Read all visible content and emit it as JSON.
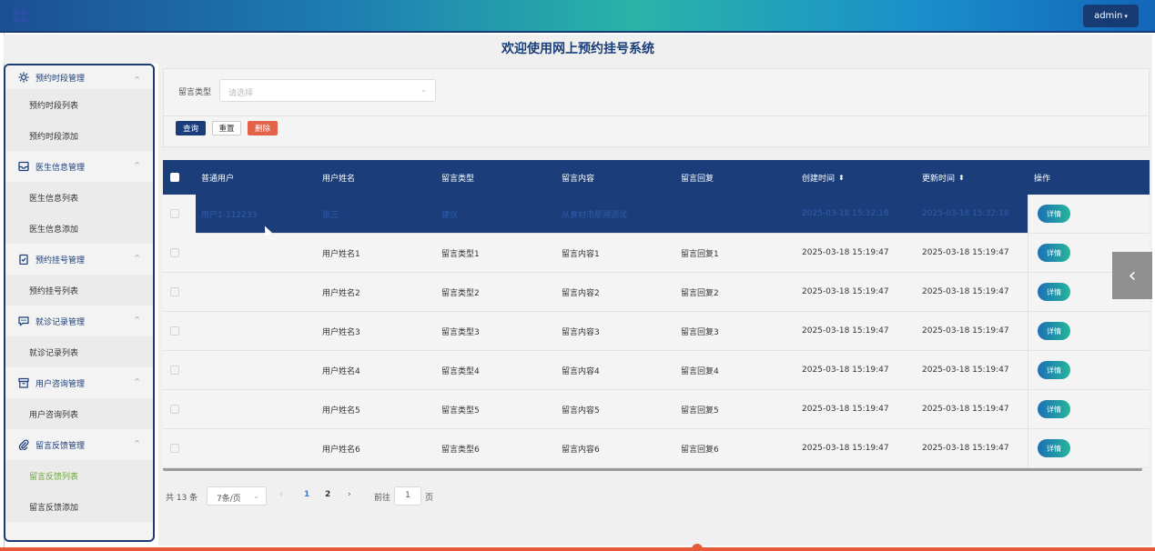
{
  "header": {
    "user_label": "admin"
  },
  "page_title": "欢迎使用网上预约挂号系统",
  "sidebar": {
    "groups": [
      {
        "label": "预约时段管理",
        "icon": "gear-icon",
        "items": [
          "预约时段列表",
          "预约时段添加"
        ]
      },
      {
        "label": "医生信息管理",
        "icon": "inbox-icon",
        "items": [
          "医生信息列表",
          "医生信息添加"
        ]
      },
      {
        "label": "预约挂号管理",
        "icon": "clipboard-check-icon",
        "items": [
          "预约挂号列表"
        ]
      },
      {
        "label": "就诊记录管理",
        "icon": "chat-icon",
        "items": [
          "就诊记录列表"
        ]
      },
      {
        "label": "用户咨询管理",
        "icon": "archive-icon",
        "items": [
          "用户咨询列表"
        ]
      },
      {
        "label": "留言反馈管理",
        "icon": "paperclip-icon",
        "items": [
          "留言反馈列表",
          "留言反馈添加"
        ]
      }
    ],
    "active_item": "留言反馈列表"
  },
  "search": {
    "type_label": "留言类型",
    "type_placeholder": "请选择",
    "query_label": "查询",
    "reset_label": "重置",
    "delete_label": "删除"
  },
  "table": {
    "columns": [
      "普通用户",
      "用户姓名",
      "留言类型",
      "留言内容",
      "留言回复",
      "创建时间",
      "更新时间",
      "操作"
    ],
    "sort_icon": "⬍",
    "detail_label": "详情",
    "rows": [
      {
        "user": "用户1-112233",
        "name": "张三",
        "type": "建议",
        "content": "从食材市那溯测试",
        "reply": "",
        "created": "2025-03-18 15:32:18",
        "updated": "2025-03-18 15:32:18",
        "selected": true
      },
      {
        "user": "",
        "name": "用户姓名1",
        "type": "留言类型1",
        "content": "留言内容1",
        "reply": "留言回复1",
        "created": "2025-03-18 15:19:47",
        "updated": "2025-03-18 15:19:47"
      },
      {
        "user": "",
        "name": "用户姓名2",
        "type": "留言类型2",
        "content": "留言内容2",
        "reply": "留言回复2",
        "created": "2025-03-18 15:19:47",
        "updated": "2025-03-18 15:19:47"
      },
      {
        "user": "",
        "name": "用户姓名3",
        "type": "留言类型3",
        "content": "留言内容3",
        "reply": "留言回复3",
        "created": "2025-03-18 15:19:47",
        "updated": "2025-03-18 15:19:47"
      },
      {
        "user": "",
        "name": "用户姓名4",
        "type": "留言类型4",
        "content": "留言内容4",
        "reply": "留言回复4",
        "created": "2025-03-18 15:19:47",
        "updated": "2025-03-18 15:19:47"
      },
      {
        "user": "",
        "name": "用户姓名5",
        "type": "留言类型5",
        "content": "留言内容5",
        "reply": "留言回复5",
        "created": "2025-03-18 15:19:47",
        "updated": "2025-03-18 15:19:47"
      },
      {
        "user": "",
        "name": "用户姓名6",
        "type": "留言类型6",
        "content": "留言内容6",
        "reply": "留言回复6",
        "created": "2025-03-18 15:19:47",
        "updated": "2025-03-18 15:19:47"
      }
    ]
  },
  "pagination": {
    "total": "共 13 条",
    "page_size": "7条/页",
    "pages": [
      "1",
      "2"
    ],
    "current": "1",
    "goto_label": "前往",
    "goto_value": "1",
    "page_suffix": "页"
  }
}
